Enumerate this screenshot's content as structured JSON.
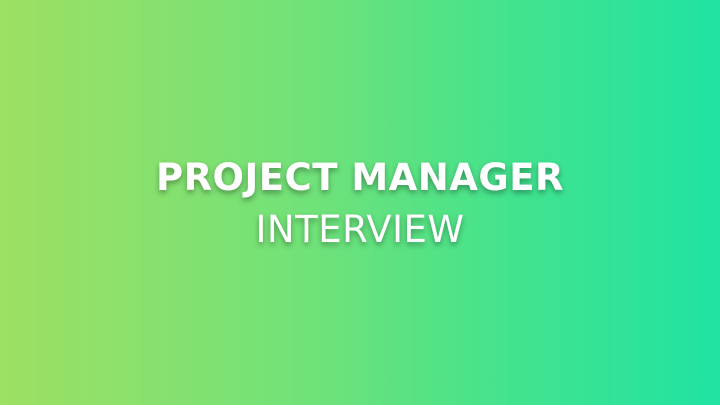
{
  "slide": {
    "title": "PROJECT MANAGER",
    "subtitle": "INTERVIEW",
    "gradient_start": "#9ee062",
    "gradient_end": "#20e3a2",
    "text_color": "#ffffff"
  }
}
